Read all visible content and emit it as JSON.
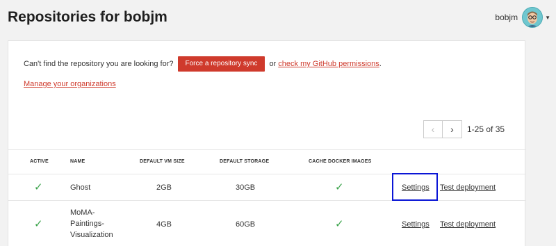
{
  "header": {
    "title": "Repositories for bobjm",
    "username": "bobjm",
    "caret": "▼"
  },
  "sync": {
    "prompt": "Can't find the repository you are looking for?",
    "button_label": "Force a repository sync",
    "or_text": "or",
    "permissions_link": "check my GitHub permissions",
    "period": ".",
    "manage_link": "Manage your organizations"
  },
  "pagination": {
    "prev_icon": "‹",
    "next_icon": "›",
    "range": "1-25 of 35"
  },
  "table": {
    "columns": [
      "ACTIVE",
      "NAME",
      "DEFAULT VM SIZE",
      "DEFAULT STORAGE",
      "CACHE DOCKER IMAGES"
    ],
    "rows": [
      {
        "active": "✓",
        "name": "Ghost",
        "vm_size": "2GB",
        "storage": "30GB",
        "cache": "✓",
        "settings_link": "Settings",
        "deploy_link": "Test deployment"
      },
      {
        "active": "✓",
        "name_lines": [
          "MoMA-",
          "Paintings-",
          "Visualization"
        ],
        "vm_size": "4GB",
        "storage": "60GB",
        "cache": "✓",
        "settings_link": "Settings",
        "deploy_link": "Test deployment"
      }
    ]
  },
  "colors": {
    "accent": "#cf3a2c",
    "check": "#3aa34a",
    "highlight": "#0b16d6"
  },
  "icons": {
    "avatar": "avatar-icon",
    "checkmark": "check-icon"
  }
}
